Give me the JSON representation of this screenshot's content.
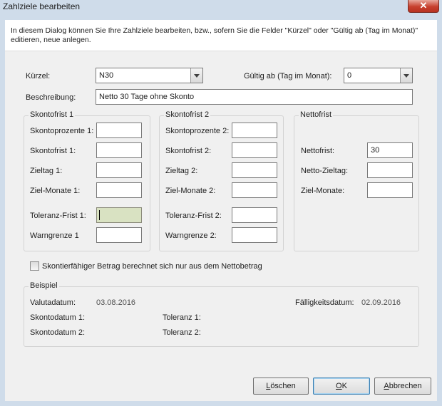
{
  "window": {
    "title": "Zahlziele bearbeiten",
    "close_glyph": "✕"
  },
  "info": {
    "text": "In diesem Dialog können Sie Ihre Zahlziele bearbeiten, bzw., sofern Sie die Felder \"Kürzel\" oder \"Gültig ab (Tag im Monat)\" editieren, neue anlegen."
  },
  "header": {
    "kuerzel_label": "Kürzel:",
    "kuerzel_value": "N30",
    "gueltig_label": "Gültig ab (Tag im Monat):",
    "gueltig_value": "0",
    "beschreibung_label": "Beschreibung:",
    "beschreibung_value": "Netto 30 Tage ohne Skonto"
  },
  "skontofrist1": {
    "title": "Skontofrist 1",
    "fields": [
      {
        "label": "Skontoprozente 1:",
        "value": ""
      },
      {
        "label": "Skontofrist 1:",
        "value": ""
      },
      {
        "label": "Zieltag 1:",
        "value": ""
      },
      {
        "label": "Ziel-Monate 1:",
        "value": ""
      },
      {
        "label": "Toleranz-Frist 1:",
        "value": ""
      },
      {
        "label": "Warngrenze 1",
        "value": ""
      }
    ]
  },
  "skontofrist2": {
    "title": "Skontofrist 2",
    "fields": [
      {
        "label": "Skontoprozente 2:",
        "value": ""
      },
      {
        "label": "Skontofrist 2:",
        "value": ""
      },
      {
        "label": "Zieltag 2:",
        "value": ""
      },
      {
        "label": "Ziel-Monate 2:",
        "value": ""
      },
      {
        "label": "Toleranz-Frist 2:",
        "value": ""
      },
      {
        "label": "Warngrenze 2:",
        "value": ""
      }
    ]
  },
  "nettofrist": {
    "title": "Nettofrist",
    "fields": [
      {
        "label": "Nettofrist:",
        "value": "30"
      },
      {
        "label": "Netto-Zieltag:",
        "value": ""
      },
      {
        "label": "Ziel-Monate:",
        "value": ""
      }
    ]
  },
  "checkbox": {
    "label": "Skontierfähiger Betrag berechnet sich nur aus dem Nettobetrag",
    "checked": false
  },
  "beispiel": {
    "title": "Beispiel",
    "valutadatum_label": "Valutadatum:",
    "valutadatum_value": "03.08.2016",
    "faelligkeit_label": "Fälligkeitsdatum:",
    "faelligkeit_value": "02.09.2016",
    "skontodatum1_label": "Skontodatum 1:",
    "skontodatum2_label": "Skontodatum 2:",
    "toleranz1_label": "Toleranz 1:",
    "toleranz2_label": "Toleranz 2:"
  },
  "buttons": {
    "loeschen_first": "L",
    "loeschen_rest": "öschen",
    "ok_first": "O",
    "ok_rest": "K",
    "abbrechen_first": "A",
    "abbrechen_rest": "bbrechen"
  }
}
